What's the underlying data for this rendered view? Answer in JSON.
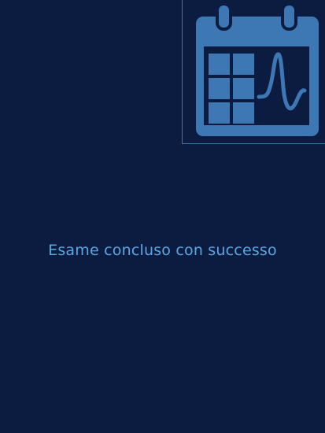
{
  "status": {
    "message": "Esame concluso con successo"
  },
  "icon": {
    "name": "calendar-chart-icon",
    "color": "#3d78b4"
  },
  "colors": {
    "background": "#0b1c40",
    "panel_border": "#3f74a8",
    "text": "#58a8e4"
  }
}
